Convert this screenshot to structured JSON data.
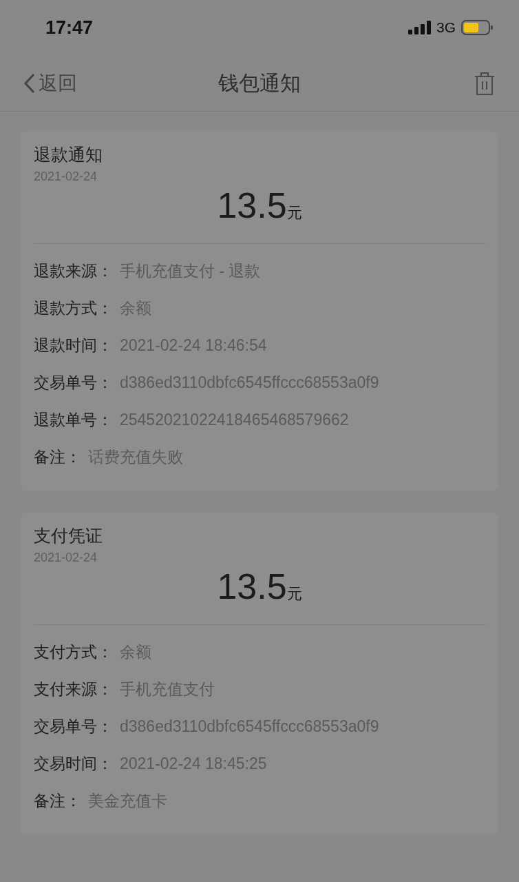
{
  "status_bar": {
    "time": "17:47",
    "network": "3G"
  },
  "nav": {
    "back": "返回",
    "title": "钱包通知"
  },
  "notices": [
    {
      "title": "退款通知",
      "date": "2021-02-24",
      "amount": "13.5",
      "unit": "元",
      "rows": [
        {
          "label": "退款来源：",
          "value": "手机充值支付 - 退款"
        },
        {
          "label": "退款方式：",
          "value": "余额"
        },
        {
          "label": "退款时间：",
          "value": "2021-02-24 18:46:54"
        },
        {
          "label": "交易单号：",
          "value": "d386ed3110dbfc6545ffccc68553a0f9"
        },
        {
          "label": "退款单号：",
          "value": "25452021022418465468579662"
        },
        {
          "label": "备注：",
          "value": "话费充值失败"
        }
      ]
    },
    {
      "title": "支付凭证",
      "date": "2021-02-24",
      "amount": "13.5",
      "unit": "元",
      "rows": [
        {
          "label": "支付方式：",
          "value": "余额"
        },
        {
          "label": "支付来源：",
          "value": "手机充值支付"
        },
        {
          "label": "交易单号：",
          "value": "d386ed3110dbfc6545ffccc68553a0f9"
        },
        {
          "label": "交易时间：",
          "value": "2021-02-24 18:45:25"
        },
        {
          "label": "备注：",
          "value": "美金充值卡"
        }
      ]
    }
  ]
}
